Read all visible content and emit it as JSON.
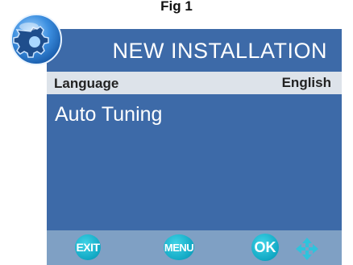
{
  "figure": {
    "caption": "Fig 1"
  },
  "header": {
    "title": "NEW INSTALLATION"
  },
  "menu": {
    "language_label": "Language",
    "language_value": "English",
    "auto_tuning_label": "Auto Tuning"
  },
  "footer": {
    "exit_label": "EXIT",
    "menu_label": "MENU",
    "ok_label": "OK"
  },
  "colors": {
    "panel_blue": "#3d6aa8",
    "selected_row": "#dde3ea",
    "footer_bar": "#7fa0c4",
    "button_cyan": "#11a8c4"
  },
  "icons": [
    "settings-gear-icon",
    "navigation-arrows-icon"
  ]
}
